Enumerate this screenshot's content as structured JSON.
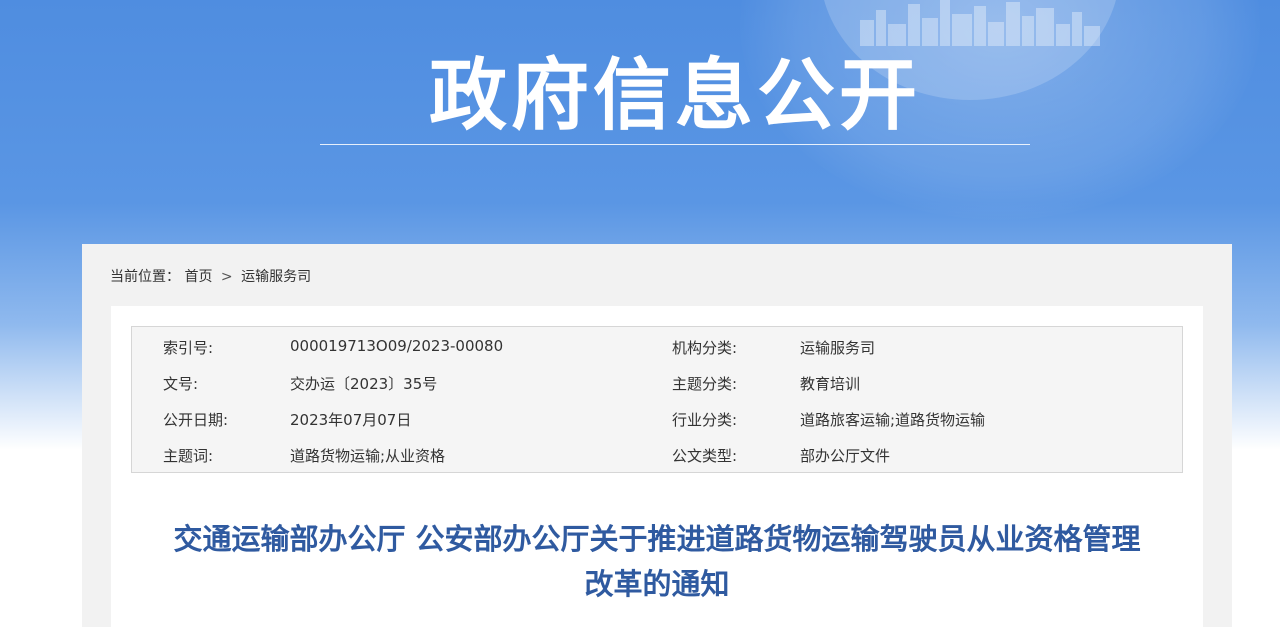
{
  "banner": {
    "title": "政府信息公开"
  },
  "breadcrumb": {
    "prefix": "当前位置：",
    "home": "首页",
    "separator": ">",
    "current": "运输服务司"
  },
  "meta": {
    "rows": [
      {
        "label_left": "索引号:",
        "value_left": "000019713O09/2023-00080",
        "label_right": "机构分类:",
        "value_right": "运输服务司"
      },
      {
        "label_left": "文号:",
        "value_left": "交办运〔2023〕35号",
        "label_right": "主题分类:",
        "value_right": "教育培训"
      },
      {
        "label_left": "公开日期:",
        "value_left": "2023年07月07日",
        "label_right": "行业分类:",
        "value_right": "道路旅客运输;道路货物运输"
      },
      {
        "label_left": "主题词:",
        "value_left": "道路货物运输;从业资格",
        "label_right": "公文类型:",
        "value_right": "部办公厅文件"
      }
    ]
  },
  "document": {
    "title_line1": "交通运输部办公厅 公安部办公厅关于推进道路货物运输驾驶员从业资格管理",
    "title_line2": "改革的通知"
  },
  "colors": {
    "banner_blue": "#4f8de0",
    "title_blue": "#2f5aa0",
    "panel_gray": "#f2f2f2",
    "meta_bg": "#f5f5f5"
  }
}
